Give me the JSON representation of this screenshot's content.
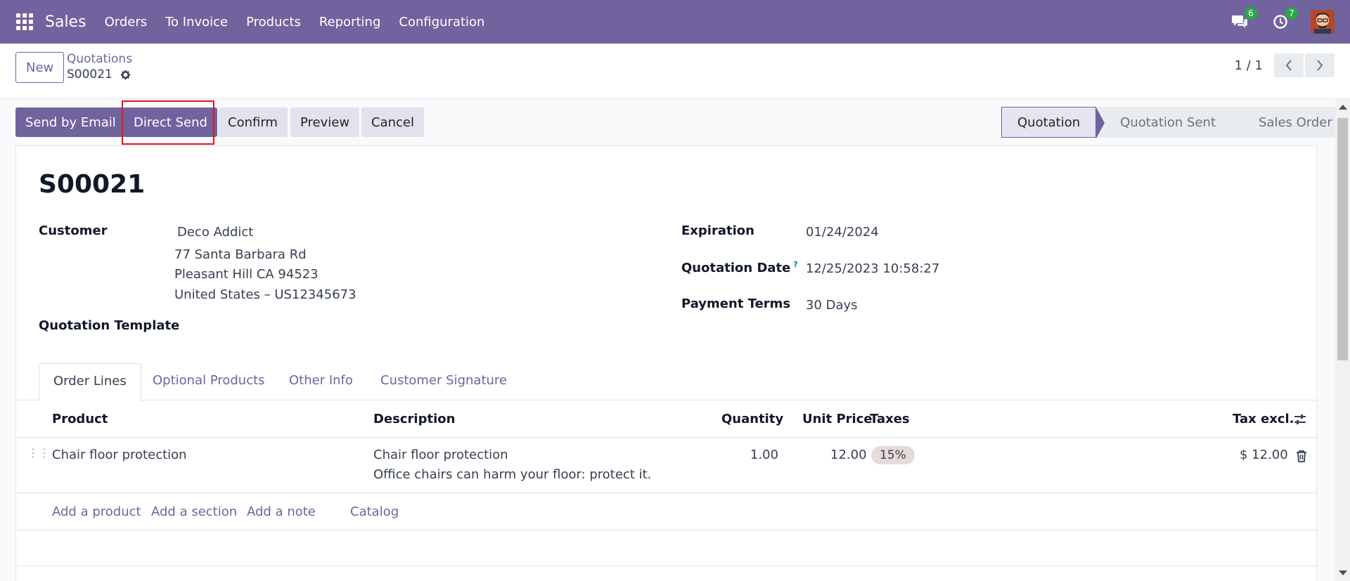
{
  "navbar": {
    "app_name": "Sales",
    "menu": [
      "Orders",
      "To Invoice",
      "Products",
      "Reporting",
      "Configuration"
    ],
    "messages_count": "6",
    "activities_count": "7"
  },
  "control": {
    "new_label": "New",
    "breadcrumb_parent": "Quotations",
    "breadcrumb_current": "S00021",
    "pager": "1 / 1"
  },
  "actions": {
    "send_email": "Send by Email",
    "direct_send": "Direct Send",
    "confirm": "Confirm",
    "preview": "Preview",
    "cancel": "Cancel"
  },
  "status": {
    "stages": [
      "Quotation",
      "Quotation Sent",
      "Sales Order"
    ],
    "active": "Quotation"
  },
  "form": {
    "title": "S00021",
    "customer_label": "Customer",
    "customer_name": "Deco Addict",
    "address_line1": "77 Santa Barbara Rd",
    "address_line2": "Pleasant Hill CA 94523",
    "address_line3": "United States – US12345673",
    "template_label": "Quotation Template",
    "expiration_label": "Expiration",
    "expiration_value": "01/24/2024",
    "quotation_date_label": "Quotation Date",
    "quotation_date_help": "?",
    "quotation_date_value": "12/25/2023 10:58:27",
    "payment_terms_label": "Payment Terms",
    "payment_terms_value": "30 Days"
  },
  "tabs": [
    "Order Lines",
    "Optional Products",
    "Other Info",
    "Customer Signature"
  ],
  "table": {
    "headers": {
      "product": "Product",
      "description": "Description",
      "quantity": "Quantity",
      "unit_price": "Unit Price",
      "taxes": "Taxes",
      "tax_excl": "Tax excl."
    },
    "rows": [
      {
        "product": "Chair floor protection",
        "description_line1": "Chair floor protection",
        "description_line2": "Office chairs can harm your floor: protect it.",
        "quantity": "1.00",
        "unit_price": "12.00",
        "tax": "15%",
        "subtotal": "$ 12.00"
      }
    ],
    "add_links": {
      "add_product": "Add a product",
      "add_section": "Add a section",
      "add_note": "Add a note",
      "catalog": "Catalog"
    }
  },
  "colors": {
    "brand": "#71639e",
    "highlight": "#e5141e"
  }
}
